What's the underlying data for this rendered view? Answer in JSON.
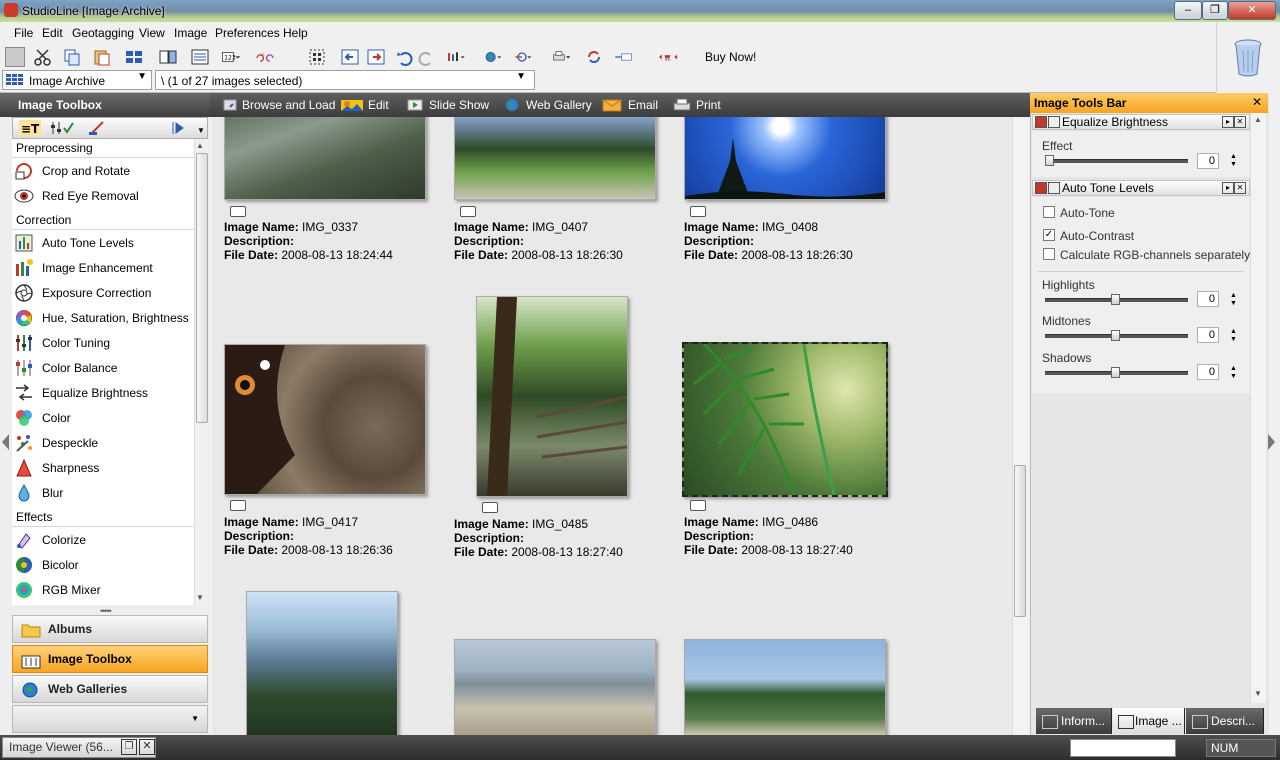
{
  "window": {
    "title": "StudioLine [Image Archive]"
  },
  "menu": [
    "File",
    "Edit",
    "Geotagging",
    "View",
    "Image",
    "Preferences",
    "Help"
  ],
  "toolbar": {
    "buy_now": "Buy Now!"
  },
  "pathbar": {
    "archive_label": "Image Archive",
    "path_value": "\\ (1 of 27 images selected)"
  },
  "left": {
    "header": "Image Toolbox",
    "sections": [
      {
        "name": "Preprocessing",
        "tools": [
          {
            "label": "Crop and Rotate",
            "icon": "crop-icon"
          },
          {
            "label": "Red Eye Removal",
            "icon": "eye-icon"
          }
        ]
      },
      {
        "name": "Correction",
        "tools": [
          {
            "label": "Auto Tone Levels",
            "icon": "auto-tone-icon"
          },
          {
            "label": "Image Enhancement",
            "icon": "enhance-icon"
          },
          {
            "label": "Exposure Correction",
            "icon": "aperture-icon"
          },
          {
            "label": "Hue, Saturation, Brightness",
            "icon": "color-wheel-icon"
          },
          {
            "label": "Color Tuning",
            "icon": "color-tuning-icon"
          },
          {
            "label": "Color Balance",
            "icon": "color-balance-icon"
          },
          {
            "label": "Equalize Brightness",
            "icon": "equalize-icon"
          },
          {
            "label": "Color",
            "icon": "color-dots-icon"
          },
          {
            "label": "Despeckle",
            "icon": "despeckle-icon"
          },
          {
            "label": "Sharpness",
            "icon": "sharpness-icon"
          },
          {
            "label": "Blur",
            "icon": "blur-drop-icon"
          }
        ]
      },
      {
        "name": "Effects",
        "tools": [
          {
            "label": "Colorize",
            "icon": "colorize-icon"
          },
          {
            "label": "Bicolor",
            "icon": "bicolor-icon"
          },
          {
            "label": "RGB Mixer",
            "icon": "rgb-mixer-icon"
          }
        ]
      }
    ],
    "nav": [
      "Albums",
      "Image Toolbox",
      "Web Galleries"
    ]
  },
  "center": {
    "tabs": [
      "Browse and Load",
      "Edit",
      "Slide Show",
      "Web Gallery",
      "Email",
      "Print"
    ],
    "labels": {
      "name": "Image Name:",
      "description": "Description:",
      "date": "File Date:"
    },
    "images": [
      {
        "name": "IMG_0337",
        "date": "2008-08-13 18:24:44"
      },
      {
        "name": "IMG_0407",
        "date": "2008-08-13 18:26:30"
      },
      {
        "name": "IMG_0408",
        "date": "2008-08-13 18:26:30"
      },
      {
        "name": "IMG_0417",
        "date": "2008-08-13 18:26:36"
      },
      {
        "name": "IMG_0485",
        "date": "2008-08-13 18:27:40"
      },
      {
        "name": "IMG_0486",
        "date": "2008-08-13 18:27:40",
        "selected": true
      }
    ]
  },
  "right": {
    "header": "Image Tools Bar",
    "equalize": {
      "title": "Equalize Brightness",
      "effect_label": "Effect",
      "effect_value": "0"
    },
    "autotone": {
      "title": "Auto Tone Levels",
      "checks": [
        {
          "label": "Auto-Tone",
          "checked": false
        },
        {
          "label": "Auto-Contrast",
          "checked": true
        },
        {
          "label": "Calculate RGB-channels separately",
          "checked": false
        }
      ],
      "sliders": [
        {
          "label": "Highlights",
          "value": "0"
        },
        {
          "label": "Midtones",
          "value": "0"
        },
        {
          "label": "Shadows",
          "value": "0"
        }
      ]
    },
    "tabs": [
      "Inform...",
      "Image ...",
      "Descri..."
    ]
  },
  "status": {
    "viewer_tab": "Image Viewer (56...",
    "num": "NUM"
  }
}
